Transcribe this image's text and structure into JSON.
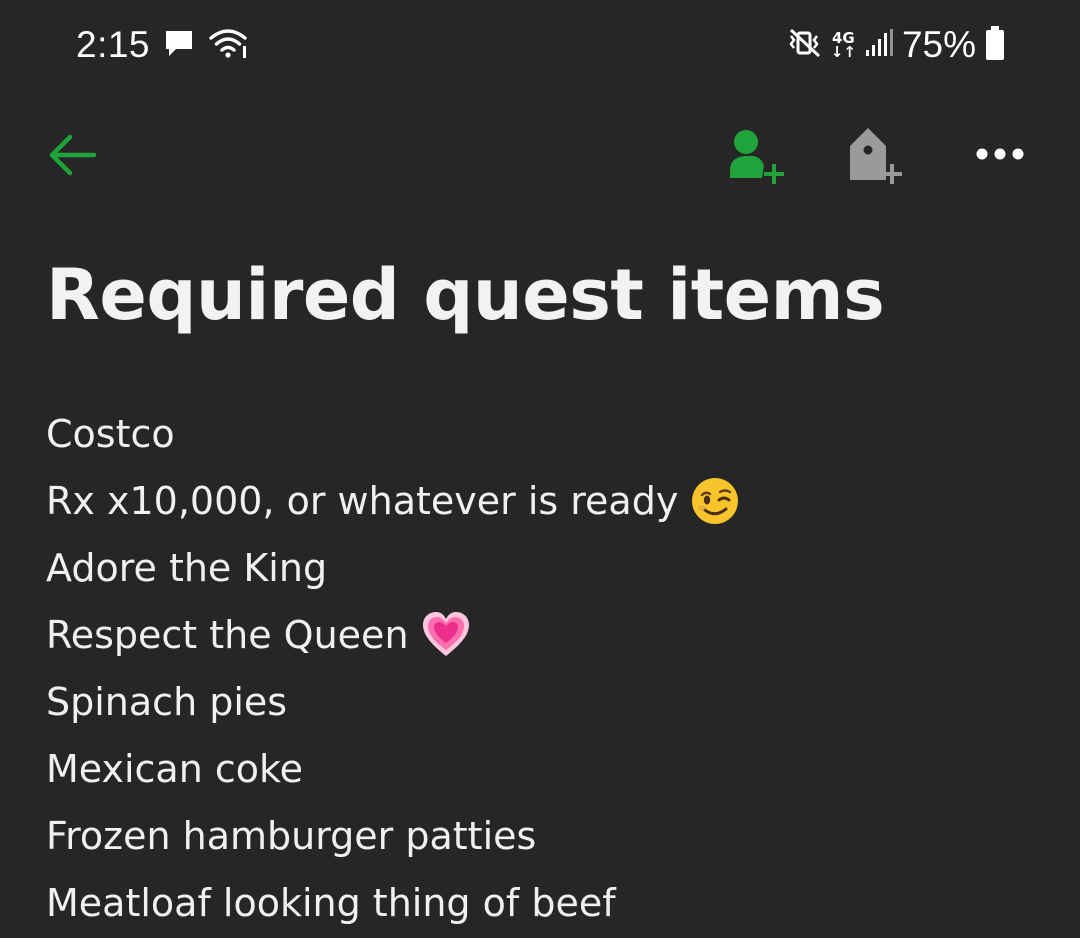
{
  "status_bar": {
    "time": "2:15",
    "battery_percent": "75%",
    "network_label_top": "4G",
    "network_label_bottom": "↓↑",
    "icons": [
      "message-icon",
      "wifi-icon",
      "mute-vibrate-icon",
      "signal-icon",
      "battery-icon"
    ]
  },
  "toolbar": {
    "icons": [
      "back-arrow-icon",
      "add-person-icon",
      "add-tag-icon",
      "more-options-icon"
    ],
    "accent_color": "#1fa33a",
    "muted_icon_color": "#9a9a9a"
  },
  "note": {
    "title": "Required quest items",
    "lines": [
      {
        "text": "Costco"
      },
      {
        "text": "Rx x10,000, or whatever is ready",
        "emoji": "wink"
      },
      {
        "text": "Adore the King"
      },
      {
        "text": "Respect the Queen",
        "emoji": "heart"
      },
      {
        "text": "Spinach pies"
      },
      {
        "text": "Mexican coke"
      },
      {
        "text": "Frozen hamburger patties"
      },
      {
        "text": "Meatloaf looking thing of beef"
      }
    ]
  },
  "colors": {
    "background": "#262626",
    "text": "#f0f0f0"
  }
}
